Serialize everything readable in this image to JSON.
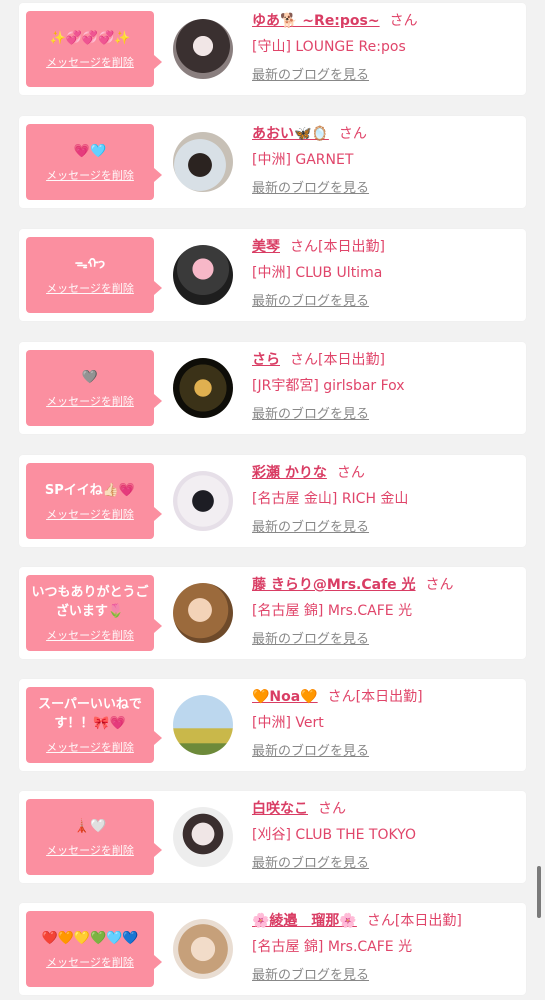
{
  "colors": {
    "accent": "#fb8fa0",
    "name": "#d93d64",
    "link": "#888888",
    "background": "#f2f2f2"
  },
  "delete_label": "メッセージを削除",
  "blog_label": "最新のブログを見る",
  "items": [
    {
      "message": "✨💞💞💞✨",
      "name": "ゆあ🐕 ~Re:pos~",
      "suffix": "さん",
      "shop": "[守山] LOUNGE Re:pos",
      "avatar": "photo"
    },
    {
      "message": "💗🩵",
      "name": "あおい🦋🪞",
      "suffix": "さん",
      "shop": "[中洲] GARNET",
      "avatar": "photo"
    },
    {
      "message": "ᯓᡣ𐭩",
      "name": "美琴",
      "suffix": "さん[本日出勤]",
      "shop": "[中洲] CLUB Ultima",
      "avatar": "photo"
    },
    {
      "message": "🩶",
      "name": "さら",
      "suffix": "さん[本日出勤]",
      "shop": "[JR宇都宮] girlsbar Fox",
      "avatar": "photo"
    },
    {
      "message": "SPイイね👍🏻💗",
      "name": "彩瀬 かりな",
      "suffix": "さん",
      "shop": "[名古屋 金山] RICH 金山",
      "avatar": "photo"
    },
    {
      "message": "いつもありがとうございます🌷",
      "name": "藤 きらり@Mrs.Cafe 光",
      "suffix": "さん",
      "shop": "[名古屋 錦] Mrs.CAFE 光",
      "avatar": "photo"
    },
    {
      "message": "スーパーいいねです！！🎀💗",
      "name": "🧡Noa🧡",
      "suffix": "さん[本日出勤]",
      "shop": "[中洲] Vert",
      "avatar": "photo"
    },
    {
      "message": "🗼🤍",
      "name": "白咲なこ",
      "suffix": "さん",
      "shop": "[刈谷] CLUB THE TOKYO",
      "avatar": "photo"
    },
    {
      "message": "❤️🧡💛💚🩵💙",
      "name": "🌸綾邉　瑠那🌸",
      "suffix": "さん[本日出勤]",
      "shop": "[名古屋 錦] Mrs.CAFE 光",
      "avatar": "photo"
    }
  ]
}
